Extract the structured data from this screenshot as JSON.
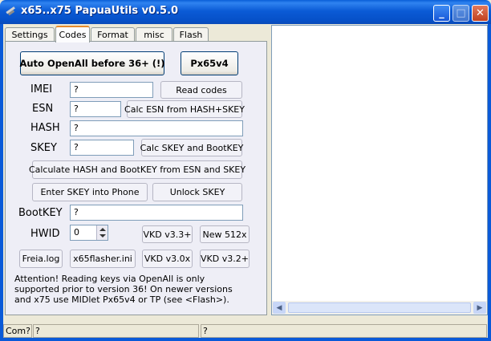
{
  "window": {
    "title": "x65..x75 PapuaUtils v0.5.0",
    "minimize_symbol": "_",
    "maximize_symbol": "□",
    "close_symbol": "✕"
  },
  "tabs": [
    {
      "label": "Settings",
      "active": false
    },
    {
      "label": "Codes",
      "active": true
    },
    {
      "label": "Format",
      "active": false
    },
    {
      "label": "misc",
      "active": false
    },
    {
      "label": "Flash",
      "active": false
    }
  ],
  "codes": {
    "auto_openall_label": "Auto OpenAll before 36+ (!)",
    "px65v4_label": "Px65v4",
    "imei": {
      "label": "IMEI",
      "value": "?"
    },
    "read_codes_label": "Read codes",
    "esn": {
      "label": "ESN",
      "value": "?"
    },
    "calc_esn_label": "Calc ESN from HASH+SKEY",
    "hash": {
      "label": "HASH",
      "value": "?"
    },
    "skey": {
      "label": "SKEY",
      "value": "?"
    },
    "calc_skey_label": "Calc SKEY and BootKEY",
    "calc_hash_label": "Calculate HASH and BootKEY from ESN and SKEY",
    "enter_skey_label": "Enter SKEY into Phone",
    "unlock_skey_label": "Unlock SKEY",
    "bootkey": {
      "label": "BootKEY",
      "value": "?"
    },
    "hwid": {
      "label": "HWID",
      "value": "0"
    },
    "vkd33_label": "VKD v3.3+",
    "new512_label": "New 512x",
    "freia_label": "Freia.log",
    "flasher_ini_label": "x65flasher.ini",
    "vkd30_label": "VKD v3.0x",
    "vkd32_label": "VKD v3.2+",
    "note_lines": [
      "Attention! Reading keys via OpenAll is only",
      "supported prior to version 36! On newer versions",
      "and x75 use MIDlet Px65v4 or TP (see <Flash>)."
    ]
  },
  "statusbar": {
    "port_label": "Com?",
    "field1": "?",
    "field2": "?"
  },
  "colors": {
    "titlebar": "#0a5ad8",
    "active_tab_accent": "#e68b2c",
    "panel_bg": "#eeeef6"
  }
}
